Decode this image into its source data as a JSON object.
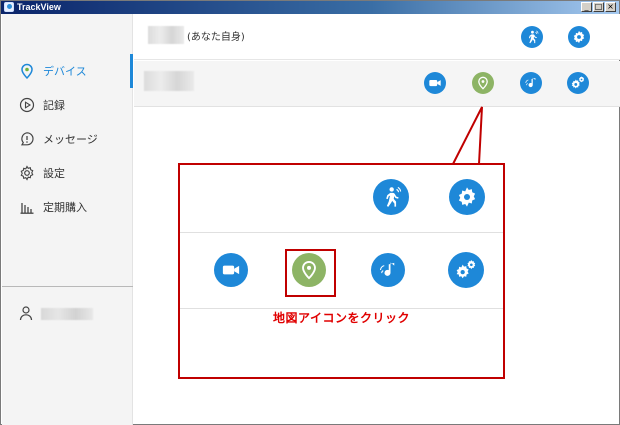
{
  "window": {
    "title": "TrackView",
    "buttons": [
      "_",
      "□",
      "×"
    ]
  },
  "sidebar": {
    "items": [
      {
        "label": "デバイス",
        "icon": "location-pin-icon",
        "active": true
      },
      {
        "label": "記録",
        "icon": "play-circle-icon",
        "active": false
      },
      {
        "label": "メッセージ",
        "icon": "message-alert-icon",
        "active": false
      },
      {
        "label": "設定",
        "icon": "gear-icon",
        "active": false
      },
      {
        "label": "定期購入",
        "icon": "bar-chart-icon",
        "active": false
      }
    ],
    "user_icon": "user-icon"
  },
  "devices": [
    {
      "suffix": "(あなた自身)",
      "actions": [
        "walking-person-icon",
        "gear-icon"
      ]
    },
    {
      "suffix": "",
      "actions": [
        "video-camera-icon",
        "map-pin-icon",
        "music-note-icon",
        "gears-icon"
      ]
    }
  ],
  "callout": {
    "instruction": "地図アイコンをクリック"
  },
  "colors": {
    "accent": "#1e88d8",
    "map_green": "#8db465",
    "highlight_red": "#c00000",
    "instruction_red": "#e00000"
  }
}
